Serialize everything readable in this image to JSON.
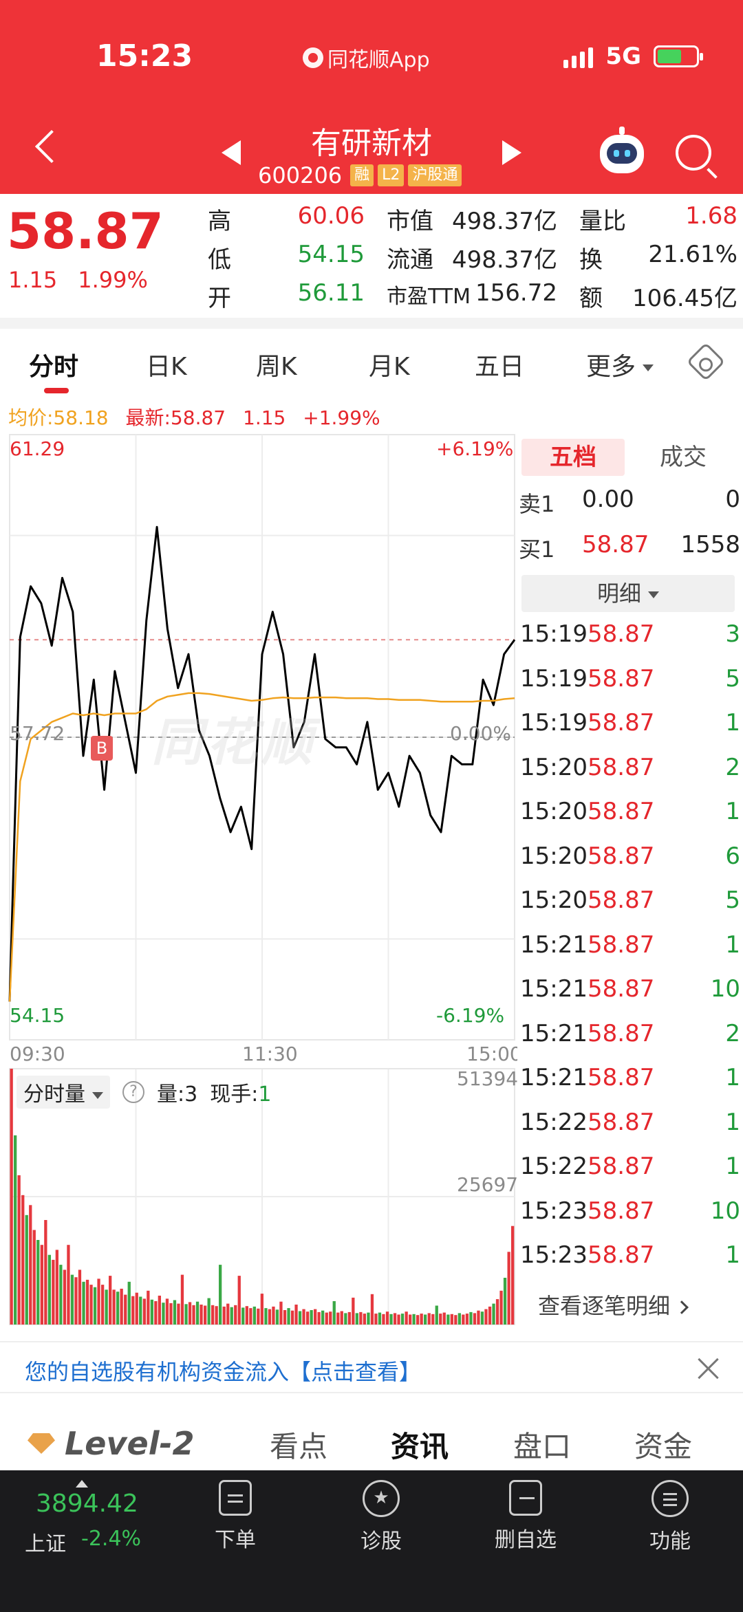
{
  "status_bar": {
    "time": "15:23",
    "app_label": "同花顺App",
    "network": "5G"
  },
  "header": {
    "stock_name": "有研新材",
    "stock_code": "600206",
    "tags": [
      "融",
      "L2",
      "沪股通"
    ]
  },
  "quote": {
    "price": "58.87",
    "change": "1.15",
    "change_pct": "1.99%",
    "high_label": "高",
    "high": "60.06",
    "low_label": "低",
    "low": "54.15",
    "open_label": "开",
    "open": "56.11",
    "mktcap_label": "市值",
    "mktcap": "498.37亿",
    "float_label": "流通",
    "float": "498.37亿",
    "pe_label": "市盈TTM",
    "pe": "156.72",
    "vol_ratio_label": "量比",
    "vol_ratio": "1.68",
    "turnover_label": "换",
    "turnover": "21.61%",
    "amount_label": "额",
    "amount": "106.45亿"
  },
  "tabs": [
    "分时",
    "日K",
    "周K",
    "月K",
    "五日",
    "更多"
  ],
  "avg_line": {
    "avg": "均价:58.18",
    "latest": "最新:58.87",
    "change": "1.15",
    "change_pct": "+1.99%"
  },
  "chart_data": {
    "type": "line",
    "title": "",
    "x": [
      "09:30",
      "09:35",
      "09:40",
      "09:45",
      "09:50",
      "09:55",
      "10:00",
      "10:05",
      "10:10",
      "10:15",
      "10:20",
      "10:25",
      "10:30",
      "10:35",
      "10:40",
      "10:45",
      "10:50",
      "10:55",
      "11:00",
      "11:05",
      "11:10",
      "11:15",
      "11:20",
      "11:25",
      "11:30",
      "13:05",
      "13:10",
      "13:15",
      "13:20",
      "13:25",
      "13:30",
      "13:35",
      "13:40",
      "13:45",
      "13:50",
      "13:55",
      "14:00",
      "14:05",
      "14:10",
      "14:15",
      "14:20",
      "14:25",
      "14:30",
      "14:35",
      "14:40",
      "14:45",
      "14:50",
      "14:55",
      "15:00"
    ],
    "x_tick_labels": [
      "09:30",
      "11:30",
      "15:00"
    ],
    "ylim": [
      54.15,
      61.29
    ],
    "y_left_labels": [
      "61.29",
      "57.72",
      "54.15"
    ],
    "y_right_labels": [
      "+6.19%",
      "0.00%",
      "-6.19%"
    ],
    "prev_close": 57.72,
    "series": [
      {
        "name": "最新",
        "color": "#000000",
        "values": [
          54.6,
          58.9,
          59.5,
          59.3,
          58.8,
          59.6,
          59.2,
          57.5,
          58.4,
          57.1,
          58.5,
          57.9,
          57.3,
          59.1,
          60.2,
          59.0,
          58.3,
          58.7,
          57.8,
          57.5,
          57.0,
          56.6,
          56.9,
          56.4,
          58.7,
          59.2,
          58.7,
          57.6,
          57.9,
          58.7,
          57.7,
          57.6,
          57.6,
          57.4,
          57.9,
          57.1,
          57.3,
          56.9,
          57.5,
          57.3,
          56.8,
          56.6,
          57.5,
          57.4,
          57.4,
          58.4,
          58.1,
          58.7,
          58.87
        ]
      },
      {
        "name": "均价",
        "color": "#f0a21f",
        "values": [
          54.6,
          57.2,
          57.7,
          57.8,
          57.9,
          57.95,
          58.0,
          57.98,
          58.0,
          57.98,
          58.0,
          58.0,
          58.0,
          58.05,
          58.15,
          58.2,
          58.22,
          58.24,
          58.24,
          58.23,
          58.21,
          58.19,
          58.17,
          58.15,
          58.16,
          58.18,
          58.19,
          58.18,
          58.18,
          58.19,
          58.19,
          58.19,
          58.18,
          58.18,
          58.18,
          58.17,
          58.17,
          58.16,
          58.16,
          58.16,
          58.15,
          58.14,
          58.14,
          58.14,
          58.14,
          58.15,
          58.15,
          58.17,
          58.18
        ]
      }
    ],
    "volume": {
      "label": "分时量",
      "ymax_label": "51394",
      "ymid_label": "25697",
      "ymax": 51394,
      "values": [
        52000,
        38000,
        30000,
        26000,
        22000,
        24000,
        19000,
        17000,
        16000,
        21000,
        14000,
        13000,
        15000,
        12000,
        11000,
        16000,
        10000,
        9500,
        11000,
        8600,
        9000,
        8000,
        7500,
        9200,
        8000,
        7000,
        9800,
        7000,
        6600,
        7200,
        6000,
        8600,
        5700,
        6400,
        5600,
        5200,
        6800,
        5000,
        4700,
        5800,
        4400,
        5200,
        4300,
        4900,
        4200,
        10000,
        4100,
        4500,
        3900,
        4600,
        4000,
        3800,
        5300,
        3900,
        3700,
        12000,
        3600,
        4200,
        3500,
        3900,
        9800,
        3400,
        3700,
        3300,
        3600,
        3200,
        6200,
        3300,
        3100,
        3600,
        3000,
        4600,
        2900,
        3300,
        2800,
        4000,
        2700,
        3100,
        2600,
        2900,
        3100,
        2500,
        2800,
        2400,
        2600,
        4700,
        2400,
        2700,
        2300,
        2500,
        5400,
        2300,
        2500,
        2200,
        2400,
        6100,
        2200,
        2400,
        2100,
        2600,
        2100,
        2300,
        2000,
        2200,
        2600,
        2000,
        2100,
        1900,
        2200,
        2000,
        2300,
        2100,
        3800,
        2200,
        2400,
        2000,
        2100,
        1900,
        2300,
        2000,
        2200,
        2500,
        2300,
        2800,
        2600,
        3100,
        3600,
        4200,
        5100,
        6800,
        9400,
        14600,
        19800
      ]
    },
    "volume_stats": {
      "qty_label": "量:",
      "qty": "3",
      "hand_label": "现手:",
      "hand": "1"
    }
  },
  "order_book": {
    "tab_active": "五档",
    "tab_other": "成交",
    "sell1": {
      "label": "卖1",
      "price": "0.00",
      "vol": "0"
    },
    "buy1": {
      "label": "买1",
      "price": "58.87",
      "vol": "1558"
    },
    "detail_label": "明细",
    "ticks": [
      {
        "time": "15:19",
        "price": "58.87",
        "vol": "3"
      },
      {
        "time": "15:19",
        "price": "58.87",
        "vol": "5"
      },
      {
        "time": "15:19",
        "price": "58.87",
        "vol": "1"
      },
      {
        "time": "15:20",
        "price": "58.87",
        "vol": "2"
      },
      {
        "time": "15:20",
        "price": "58.87",
        "vol": "1"
      },
      {
        "time": "15:20",
        "price": "58.87",
        "vol": "6"
      },
      {
        "time": "15:20",
        "price": "58.87",
        "vol": "5"
      },
      {
        "time": "15:21",
        "price": "58.87",
        "vol": "1"
      },
      {
        "time": "15:21",
        "price": "58.87",
        "vol": "10"
      },
      {
        "time": "15:21",
        "price": "58.87",
        "vol": "2"
      },
      {
        "time": "15:21",
        "price": "58.87",
        "vol": "1"
      },
      {
        "time": "15:22",
        "price": "58.87",
        "vol": "1"
      },
      {
        "time": "15:22",
        "price": "58.87",
        "vol": "1"
      },
      {
        "time": "15:23",
        "price": "58.87",
        "vol": "10"
      },
      {
        "time": "15:23",
        "price": "58.87",
        "vol": "1"
      }
    ],
    "more_label": "查看逐笔明细"
  },
  "watermark": "同花顺",
  "b_marker": "B",
  "banner": {
    "text": "您的自选股有机构资金流入【点击查看】"
  },
  "bottom_tabs": {
    "level2": "Level-2",
    "items": [
      "看点",
      "资讯",
      "盘口",
      "资金"
    ],
    "active": "资讯"
  },
  "bottom_bar": {
    "index_value": "3894.42",
    "index_name": "上证",
    "index_change": "-2.4%",
    "items": [
      "下单",
      "诊股",
      "删自选",
      "功能"
    ]
  }
}
